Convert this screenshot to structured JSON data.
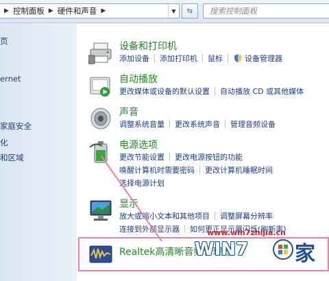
{
  "addressbar": {
    "crumbs": [
      "控制面板",
      "硬件和声音"
    ],
    "search_placeholder": "搜索控制面板",
    "refresh_glyph": "⇆"
  },
  "leftpane": {
    "items": [
      "页",
      "ernet",
      "家庭安全",
      "化",
      "和区域"
    ]
  },
  "categories": [
    {
      "title": "设备和打印机",
      "icon": "printer-icon",
      "rows": [
        [
          "添加设备",
          "添加打印机",
          "鼠标",
          "设备管理器"
        ]
      ]
    },
    {
      "title": "自动播放",
      "icon": "autoplay-icon",
      "rows": [
        [
          "更改媒体或设备的默认设置",
          "自动播放 CD 或其他媒体"
        ]
      ]
    },
    {
      "title": "声音",
      "icon": "speaker-icon",
      "rows": [
        [
          "调整系统音量",
          "更改系统声音",
          "管理音频设备"
        ]
      ]
    },
    {
      "title": "电源选项",
      "icon": "battery-icon",
      "rows": [
        [
          "更改节能设置",
          "更改电源按钮的功能"
        ],
        [
          "唤醒计算机时需要密码",
          "更改计算机睡眠时间"
        ],
        [
          "选择电源计划"
        ]
      ]
    },
    {
      "title": "显示",
      "icon": "monitor-icon",
      "rows": [
        [
          "放大或缩小文本和其他项目",
          "调整屏幕分辨率"
        ],
        [
          "连接到外部显示器",
          "如何更正显示器闪烁(刷新率)"
        ]
      ]
    },
    {
      "title": "Realtek高清晰音频管理器",
      "icon": "realtek-audio-icon",
      "rows": []
    }
  ],
  "watermark": {
    "url": "www.win7zhijia.cn",
    "brand": "WIN7",
    "brand_suffix": "家"
  },
  "colors": {
    "title_green": "#1f8a1f",
    "link_blue": "#1a3c8f",
    "highlight_pink": "#f07fa4"
  }
}
